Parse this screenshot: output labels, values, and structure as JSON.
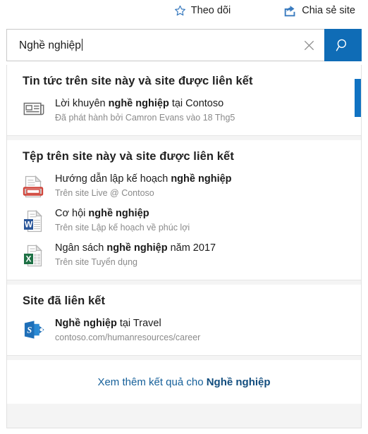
{
  "commandbar": {
    "follow": {
      "label": "Theo dõi",
      "icon": "star-icon"
    },
    "share": {
      "label": "Chia sẻ site",
      "icon": "share-icon"
    }
  },
  "search": {
    "value": "Nghề nghiệp",
    "clear_icon": "close-icon",
    "submit_icon": "search-icon",
    "button_color": "#0f6cb6"
  },
  "groups": [
    {
      "title": "Tin tức trên site này và site được liên kết",
      "results": [
        {
          "icon": "news-icon",
          "title_prefix": "Lời khuyên ",
          "title_match": "nghề nghiệp",
          "title_suffix": " tại Contoso",
          "subtitle": "Đã phát hành bởi Camron Evans vào 18 Thg5"
        }
      ]
    },
    {
      "title": "Tệp trên site này và site được liên kết",
      "results": [
        {
          "icon": "powerpoint-file-icon",
          "title_prefix": "Hướng dẫn lập kế hoạch ",
          "title_match": "nghề nghiệp",
          "title_suffix": "",
          "subtitle": "Trên site Live @ Contoso"
        },
        {
          "icon": "word-file-icon",
          "title_prefix": "Cơ hội ",
          "title_match": "nghề nghiệp",
          "title_suffix": "",
          "subtitle": "Trên site Lập kế hoạch về phúc lợi"
        },
        {
          "icon": "excel-file-icon",
          "title_prefix": "Ngân sách ",
          "title_match": "nghề nghiệp",
          "title_suffix": " năm 2017",
          "subtitle": "Trên site Tuyển dụng"
        }
      ]
    },
    {
      "title": "Site đã liên kết",
      "results": [
        {
          "icon": "sharepoint-icon",
          "title_prefix": "",
          "title_match": "Nghề nghiệp",
          "title_suffix": " tại Travel",
          "subtitle": "contoso.com/humanresources/career"
        }
      ]
    }
  ],
  "footer": {
    "link_prefix": "Xem thêm kết quả cho ",
    "link_query": "Nghề nghiệp"
  },
  "scrollbar": {
    "thumb_color": "#1072c2"
  }
}
